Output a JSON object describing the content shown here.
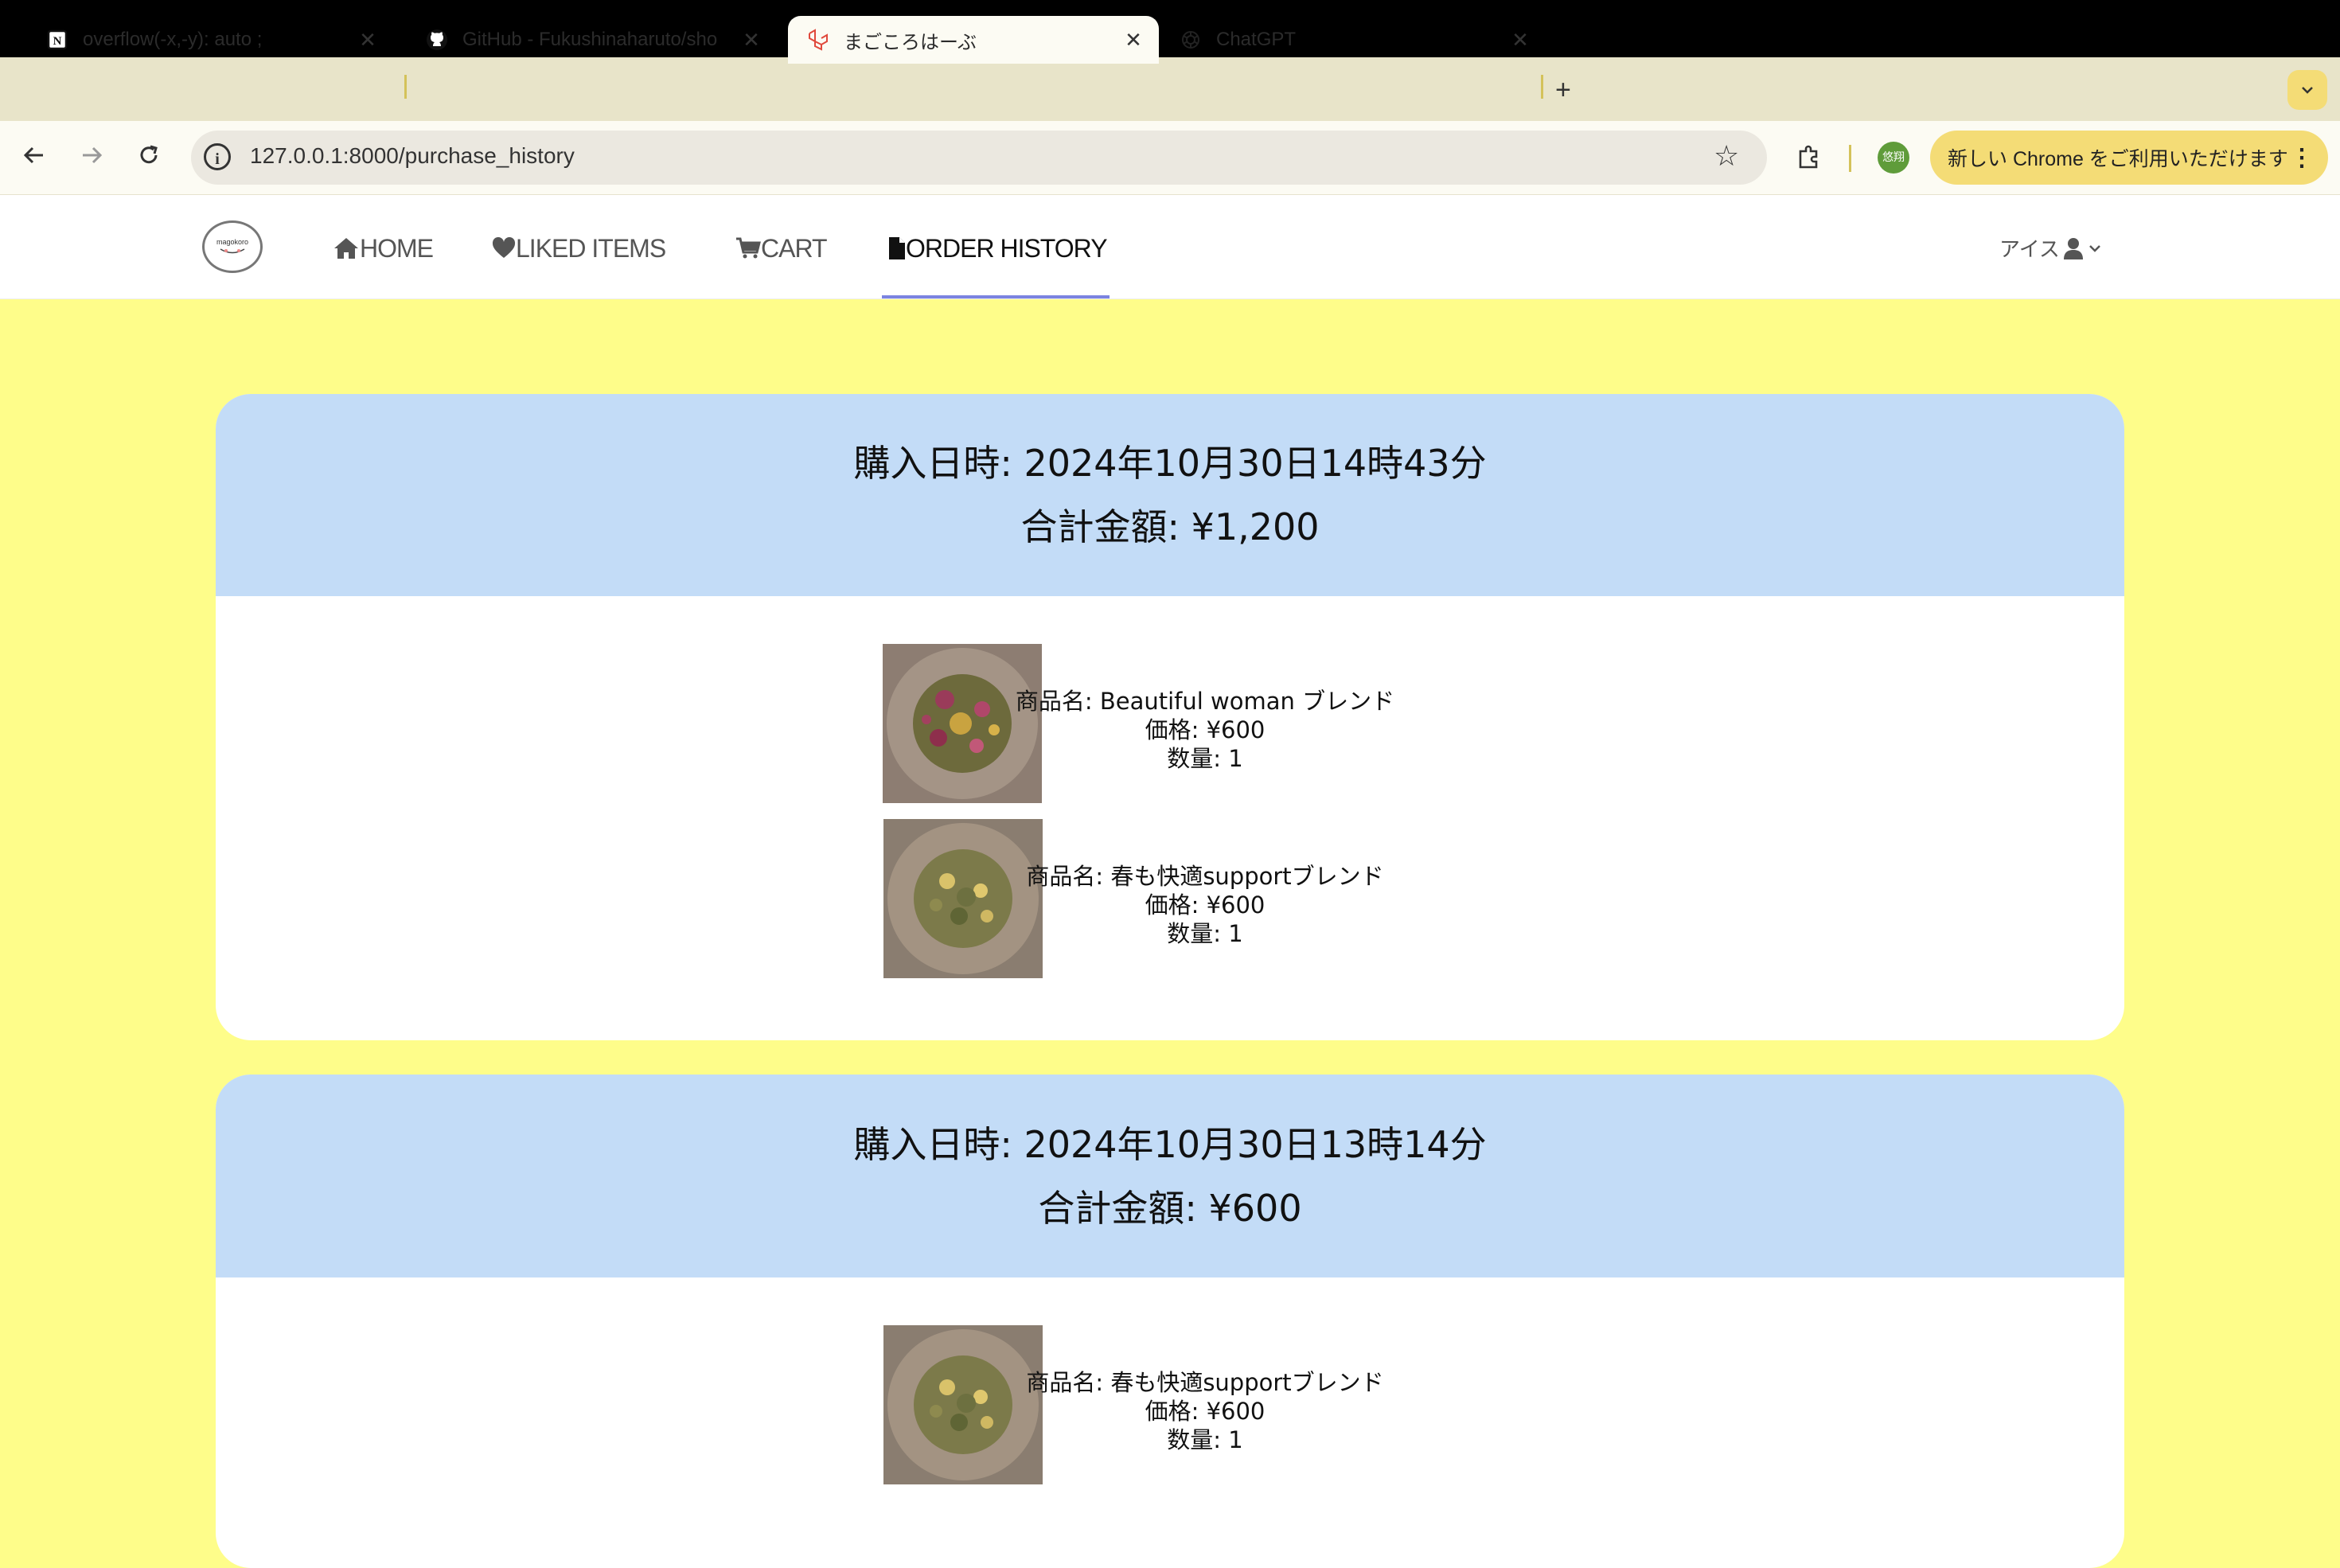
{
  "browser": {
    "tabs": [
      {
        "title": "overflow(-x,-y): auto ;",
        "icon": "notion-icon"
      },
      {
        "title": "GitHub - Fukushinaharuto/sho",
        "icon": "github-icon"
      },
      {
        "title": "まごころはーぶ",
        "icon": "laravel-icon"
      },
      {
        "title": "ChatGPT",
        "icon": "chatgpt-icon"
      }
    ],
    "url": "127.0.0.1:8000/purchase_history",
    "profile_label": "悠翔",
    "promo_text": "新しい Chrome をご利用いただけます"
  },
  "site_nav": {
    "items": [
      {
        "label": "HOME",
        "icon": "home-icon"
      },
      {
        "label": "LIKED ITEMS",
        "icon": "heart-icon"
      },
      {
        "label": "CART",
        "icon": "cart-icon"
      },
      {
        "label": "ORDER HISTORY",
        "icon": "document-icon",
        "active": true
      }
    ],
    "user_name": "アイス"
  },
  "orders": [
    {
      "date_line": "購入日時: 2024年10月30日14時43分",
      "total_line": "合計金額: ¥1,200",
      "items": [
        {
          "name": "商品名: Beautiful woman ブレンド",
          "price": "価格: ¥600",
          "qty": "数量: 1",
          "image": "rose-blend"
        },
        {
          "name": "商品名: 春も快適supportブレンド",
          "price": "価格: ¥600",
          "qty": "数量: 1",
          "image": "herb-blend"
        }
      ]
    },
    {
      "date_line": "購入日時: 2024年10月30日13時14分",
      "total_line": "合計金額: ¥600",
      "items": [
        {
          "name": "商品名: 春も快適supportブレンド",
          "price": "価格: ¥600",
          "qty": "数量: 1",
          "image": "herb-blend"
        }
      ]
    }
  ],
  "colors": {
    "page_bg": "#fefd8a",
    "card_header": "#c3dcf7",
    "nav_active_underline": "#7c84e0"
  }
}
